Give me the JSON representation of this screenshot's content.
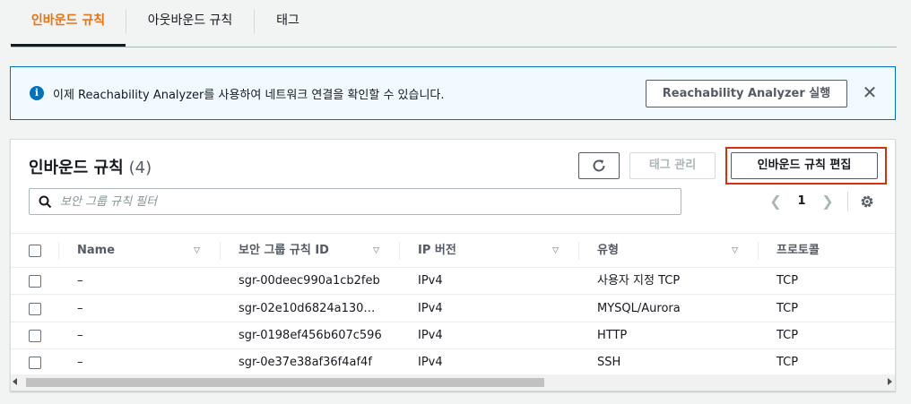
{
  "tabs": {
    "inbound": "인바운드 규칙",
    "outbound": "아웃바운드 규칙",
    "tags": "태그"
  },
  "banner": {
    "icon": "info-icon",
    "message": "이제 Reachability Analyzer를 사용하여 네트워크 연결을 확인할 수 있습니다.",
    "button_label": "Reachability Analyzer 실행",
    "close_icon": "close-icon"
  },
  "panel": {
    "title": "인바운드 규칙",
    "count": "(4)",
    "refresh_icon": "refresh-icon",
    "manage_tags_label": "태그 관리",
    "edit_rules_label": "인바운드 규칙 편집",
    "highlight_color": "#d13212",
    "search_placeholder": "보안 그룹 규칙 필터",
    "search_value": "",
    "page": "1",
    "settings_icon": "gear-icon"
  },
  "table": {
    "columns": [
      "Name",
      "보안 그룹 규칙 ID",
      "IP 버전",
      "유형",
      "프로토콜"
    ],
    "rows": [
      {
        "name": "–",
        "rule_id": "sgr-00deec990a1cb2feb",
        "ip_version": "IPv4",
        "type": "사용자 지정 TCP",
        "protocol": "TCP"
      },
      {
        "name": "–",
        "rule_id": "sgr-02e10d6824a130…",
        "ip_version": "IPv4",
        "type": "MYSQL/Aurora",
        "protocol": "TCP"
      },
      {
        "name": "–",
        "rule_id": "sgr-0198ef456b607c596",
        "ip_version": "IPv4",
        "type": "HTTP",
        "protocol": "TCP"
      },
      {
        "name": "–",
        "rule_id": "sgr-0e37e38af36f4af4f",
        "ip_version": "IPv4",
        "type": "SSH",
        "protocol": "TCP"
      }
    ]
  },
  "colors": {
    "accent": "#ec7211",
    "info": "#0073bb"
  }
}
